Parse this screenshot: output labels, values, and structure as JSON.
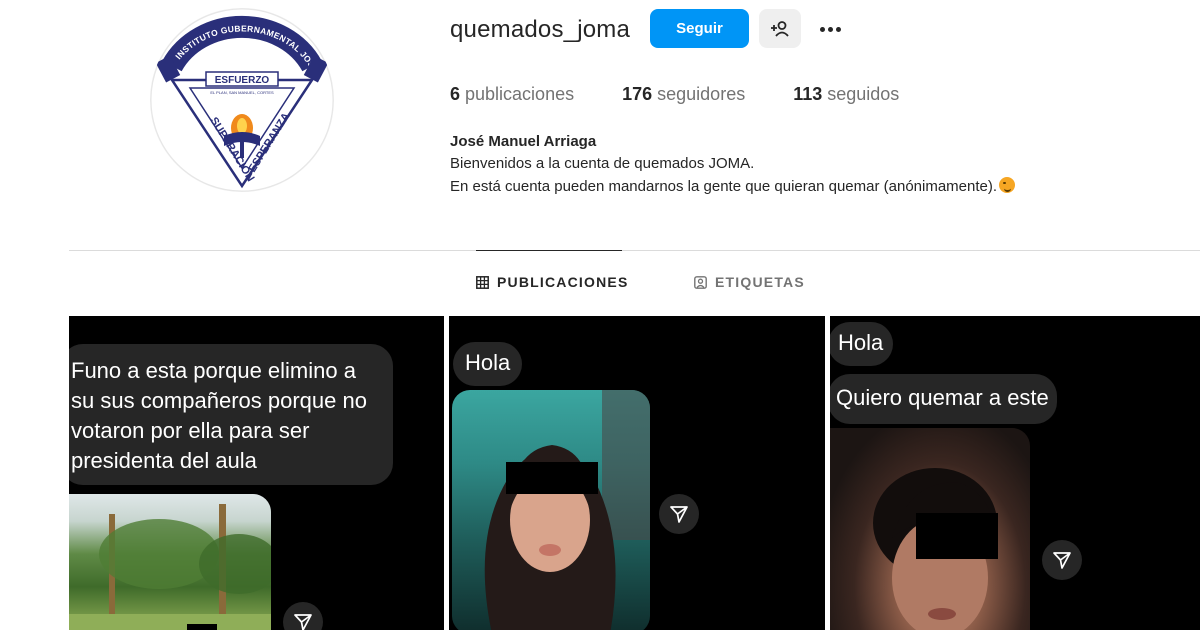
{
  "profile": {
    "username": "quemados_joma",
    "follow_label": "Seguir",
    "suggest_label": "+ዩ",
    "posts_count": "6",
    "posts_label": "publicaciones",
    "followers_count": "176",
    "followers_label": "seguidores",
    "following_count": "113",
    "following_label": "seguidos",
    "full_name": "José Manuel Arriaga",
    "bio_line1": "Bienvenidos a la cuenta de quemados JOMA.",
    "bio_line2": "En está cuenta pueden mandarnos la gente que quieran quemar (anónimamente).",
    "avatar_text": {
      "arc": "INSTITUTO GUBERNAMENTAL JOSE MANUEL ARRIAGA",
      "banner": "ESFUERZO",
      "location": "EL PLAN, SAN MANUEL, CORTES",
      "left": "SUPERACION",
      "right": "ESPERANZA"
    }
  },
  "tabs": [
    {
      "label": "PUBLICACIONES",
      "icon": "grid-icon",
      "active": true
    },
    {
      "label": "ETIQUETAS",
      "icon": "tagged-icon",
      "active": false
    }
  ],
  "posts": [
    {
      "messages": [
        "Funo a esta porque elimino a su sus compañeros porque no votaron por ella para ser presidenta del aula"
      ],
      "icon": "share-icon"
    },
    {
      "messages": [
        "Hola"
      ],
      "icon": "share-icon"
    },
    {
      "messages": [
        "Hola",
        "Quiero quemar a este"
      ],
      "icon": "share-icon"
    }
  ],
  "colors": {
    "accent": "#0095f6",
    "text": "#262626",
    "muted": "#737373",
    "bubble": "#262626"
  }
}
